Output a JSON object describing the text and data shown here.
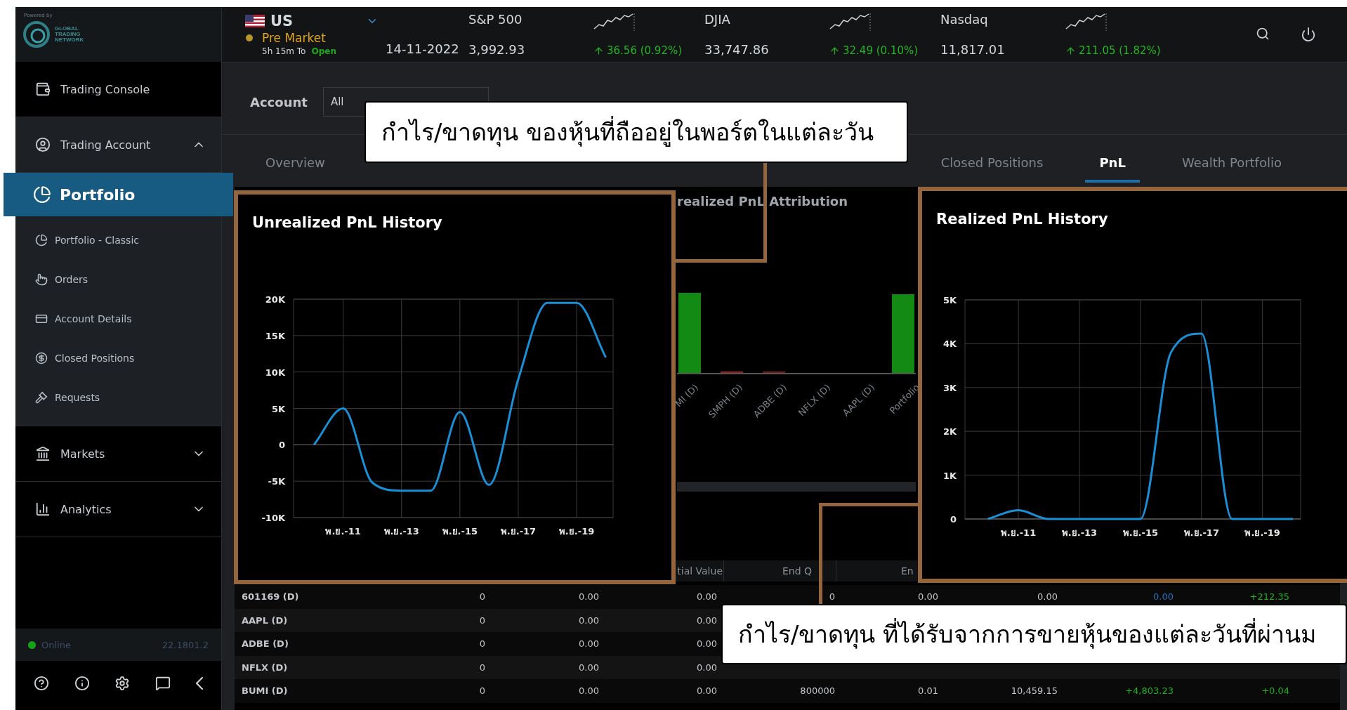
{
  "brand": {
    "powered_by": "Powered by",
    "name": "GLOBAL TRADING NETWORK"
  },
  "market": {
    "region": "US",
    "session": "Pre Market",
    "countdown": "5h 15m To",
    "next_session": "Open",
    "date": "14-11-2022"
  },
  "indices": [
    {
      "name": "S&P 500",
      "value": "3,992.93",
      "change": "36.56 (0.92%)",
      "rising": true
    },
    {
      "name": "DJIA",
      "value": "33,747.86",
      "change": "32.49 (0.10%)",
      "rising": true
    },
    {
      "name": "Nasdaq",
      "value": "11,817.01",
      "change": "211.05 (1.82%)",
      "rising": true
    }
  ],
  "sidebar": {
    "items": [
      {
        "label": "Trading Console",
        "kind": "link",
        "selected": false
      },
      {
        "label": "Trading Account",
        "kind": "group",
        "expanded": true,
        "children": [
          {
            "label": "Portfolio",
            "selected": true
          },
          {
            "label": "Portfolio - Classic",
            "selected": false
          },
          {
            "label": "Orders",
            "selected": false
          },
          {
            "label": "Account Details",
            "selected": false
          },
          {
            "label": "Closed Positions",
            "selected": false
          },
          {
            "label": "Requests",
            "selected": false
          }
        ]
      },
      {
        "label": "Markets",
        "kind": "group",
        "expanded": false
      },
      {
        "label": "Analytics",
        "kind": "group",
        "expanded": false
      }
    ],
    "status": "Online",
    "online": true,
    "version": "22.1801.2"
  },
  "filters": {
    "account_label": "Account",
    "account_value": "All"
  },
  "tabs": [
    {
      "label": "Overview",
      "selected": false
    },
    {
      "label": "Closed Positions",
      "selected": false
    },
    {
      "label": "PnL",
      "selected": true
    },
    {
      "label": "Wealth Portfolio",
      "selected": false
    }
  ],
  "attribution": {
    "title": "realized PnL Attribution",
    "labels": [
      "MI (D)",
      "SMPH (D)",
      "ADBE (D)",
      "NFLX (D)",
      "AAPL (D)",
      "Portfolio"
    ]
  },
  "table": {
    "columns": [
      "",
      "",
      "",
      "tial Value",
      "End Q",
      "En"
    ],
    "rows": [
      {
        "cells": [
          {
            "text": "601169 (D)",
            "kind": "plain"
          },
          {
            "text": "0",
            "kind": "plain"
          },
          {
            "text": "0.00",
            "kind": "plain"
          },
          {
            "text": "0.00",
            "kind": "plain"
          },
          {
            "text": "0",
            "kind": "plain"
          },
          {
            "text": "0.00",
            "kind": "plain"
          },
          {
            "text": "0.00",
            "kind": "plain"
          },
          {
            "text": "0.00",
            "kind": "flat"
          },
          {
            "text": "+212.35",
            "kind": "gain"
          }
        ]
      },
      {
        "cells": [
          {
            "text": "AAPL (D)",
            "kind": "plain"
          },
          {
            "text": "0",
            "kind": "plain"
          },
          {
            "text": "0.00",
            "kind": "plain"
          },
          {
            "text": "0.00",
            "kind": "plain"
          }
        ]
      },
      {
        "cells": [
          {
            "text": "ADBE (D)",
            "kind": "plain"
          },
          {
            "text": "0",
            "kind": "plain"
          },
          {
            "text": "0.00",
            "kind": "plain"
          },
          {
            "text": "0.00",
            "kind": "plain"
          }
        ]
      },
      {
        "cells": [
          {
            "text": "NFLX (D)",
            "kind": "plain"
          },
          {
            "text": "0",
            "kind": "plain"
          },
          {
            "text": "0.00",
            "kind": "plain"
          },
          {
            "text": "0.00",
            "kind": "plain"
          }
        ]
      },
      {
        "cells": [
          {
            "text": "BUMI (D)",
            "kind": "plain"
          },
          {
            "text": "0",
            "kind": "plain"
          },
          {
            "text": "0.00",
            "kind": "plain"
          },
          {
            "text": "0.00",
            "kind": "plain"
          },
          {
            "text": "800000",
            "kind": "plain"
          },
          {
            "text": "0.01",
            "kind": "plain"
          },
          {
            "text": "10,459.15",
            "kind": "plain"
          },
          {
            "text": "+4,803.23",
            "kind": "gain"
          },
          {
            "text": "+0.04",
            "kind": "gain"
          }
        ]
      }
    ]
  },
  "zoom_panels": [
    {
      "title": "Unrealized PnL History",
      "chart_data": {
        "type": "line",
        "categories": [
          null,
          "พ.ย.-11",
          null,
          "พ.ย.-13",
          null,
          "พ.ย.-15",
          null,
          "พ.ย.-17",
          null,
          "พ.ย.-19",
          null
        ],
        "series": [
          {
            "color": "#1a8fd6",
            "values": [
              0,
              5000,
              -5200,
              -6300,
              -6300,
              4500,
              -5500,
              9000,
              19500,
              19500,
              12000
            ]
          }
        ],
        "grid": true,
        "ylim": [
          -10000,
          20000
        ],
        "yticks": [
          {
            "value": -10000,
            "label": "-10K"
          },
          {
            "value": -5000,
            "label": "-5K"
          },
          {
            "value": 0,
            "label": "0"
          },
          {
            "value": 5000,
            "label": "5K"
          },
          {
            "value": 10000,
            "label": "10K"
          },
          {
            "value": 15000,
            "label": "15K"
          },
          {
            "value": 20000,
            "label": "20K"
          }
        ]
      }
    },
    {
      "title": "Realized PnL History",
      "chart_data": {
        "type": "line",
        "categories": [
          null,
          "พ.ย.-11",
          null,
          "พ.ย.-13",
          null,
          "พ.ย.-15",
          null,
          "พ.ย.-17",
          null,
          "พ.ย.-19",
          null
        ],
        "series": [
          {
            "color": "#1a8fd6",
            "values": [
              0,
              200,
              0,
              0,
              0,
              0,
              3800,
              4230,
              0,
              0,
              0
            ]
          }
        ],
        "grid": true,
        "ylim": [
          0,
          5000
        ],
        "yticks": [
          {
            "value": 0,
            "label": "0"
          },
          {
            "value": 1000,
            "label": "1K"
          },
          {
            "value": 2000,
            "label": "2K"
          },
          {
            "value": 3000,
            "label": "3K"
          },
          {
            "value": 4000,
            "label": "4K"
          },
          {
            "value": 5000,
            "label": "5K"
          }
        ]
      }
    }
  ],
  "callouts": [
    {
      "text": "กำไร/ขาดทุน ของหุ้นที่ถืออยู่ในพอร์ตในแต่ละวัน"
    },
    {
      "text": "กำไร/ขาดทุน ที่ได้รับจากการขายหุ้นของแต่ละวันที่ผ่านม"
    }
  ]
}
